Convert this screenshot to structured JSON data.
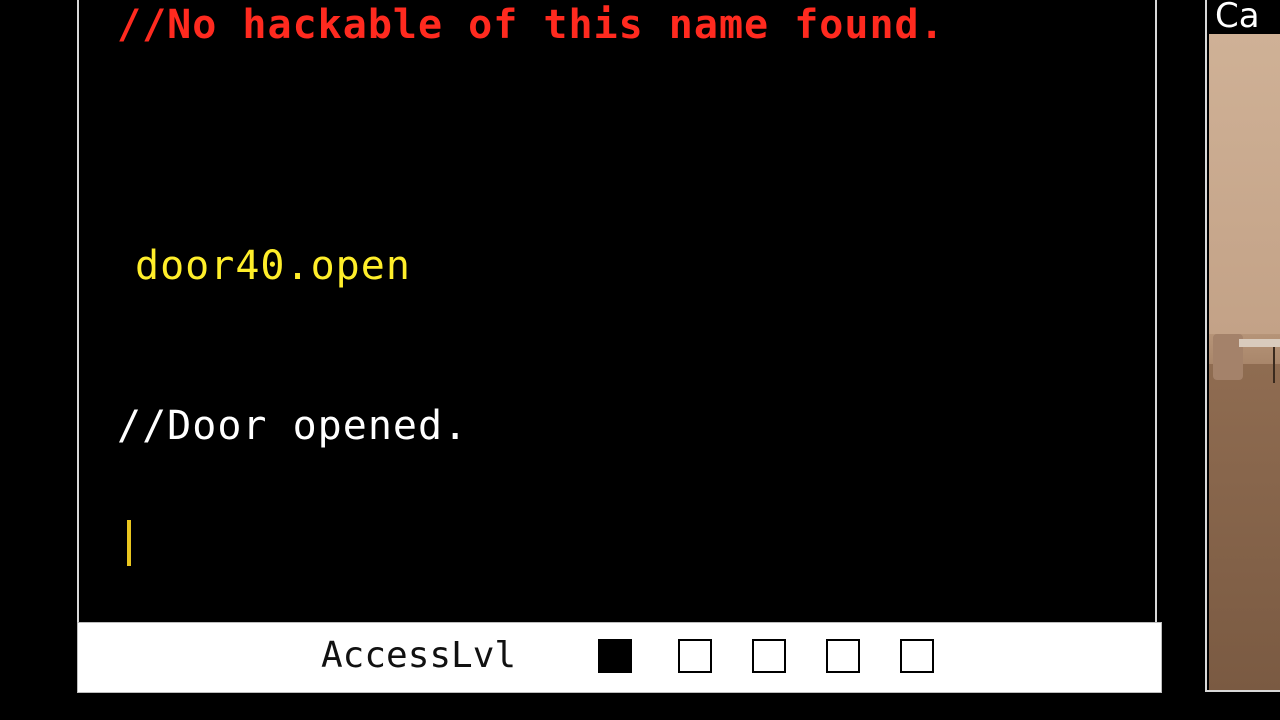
{
  "terminal": {
    "lines": [
      {
        "text": "//No hackable of this name found.",
        "kind": "error",
        "color": "#ff2a1f"
      },
      {
        "text": "door40.open",
        "kind": "command",
        "color": "#ffee2a"
      },
      {
        "text": "//Door opened.",
        "kind": "response",
        "color": "#ffffff"
      }
    ],
    "cursor_color": "#e9c61f"
  },
  "access": {
    "label": "AccessLvl",
    "level": 1,
    "max_level": 5
  },
  "side_panel": {
    "title": "Ca",
    "feed": "camera-feed-room"
  }
}
